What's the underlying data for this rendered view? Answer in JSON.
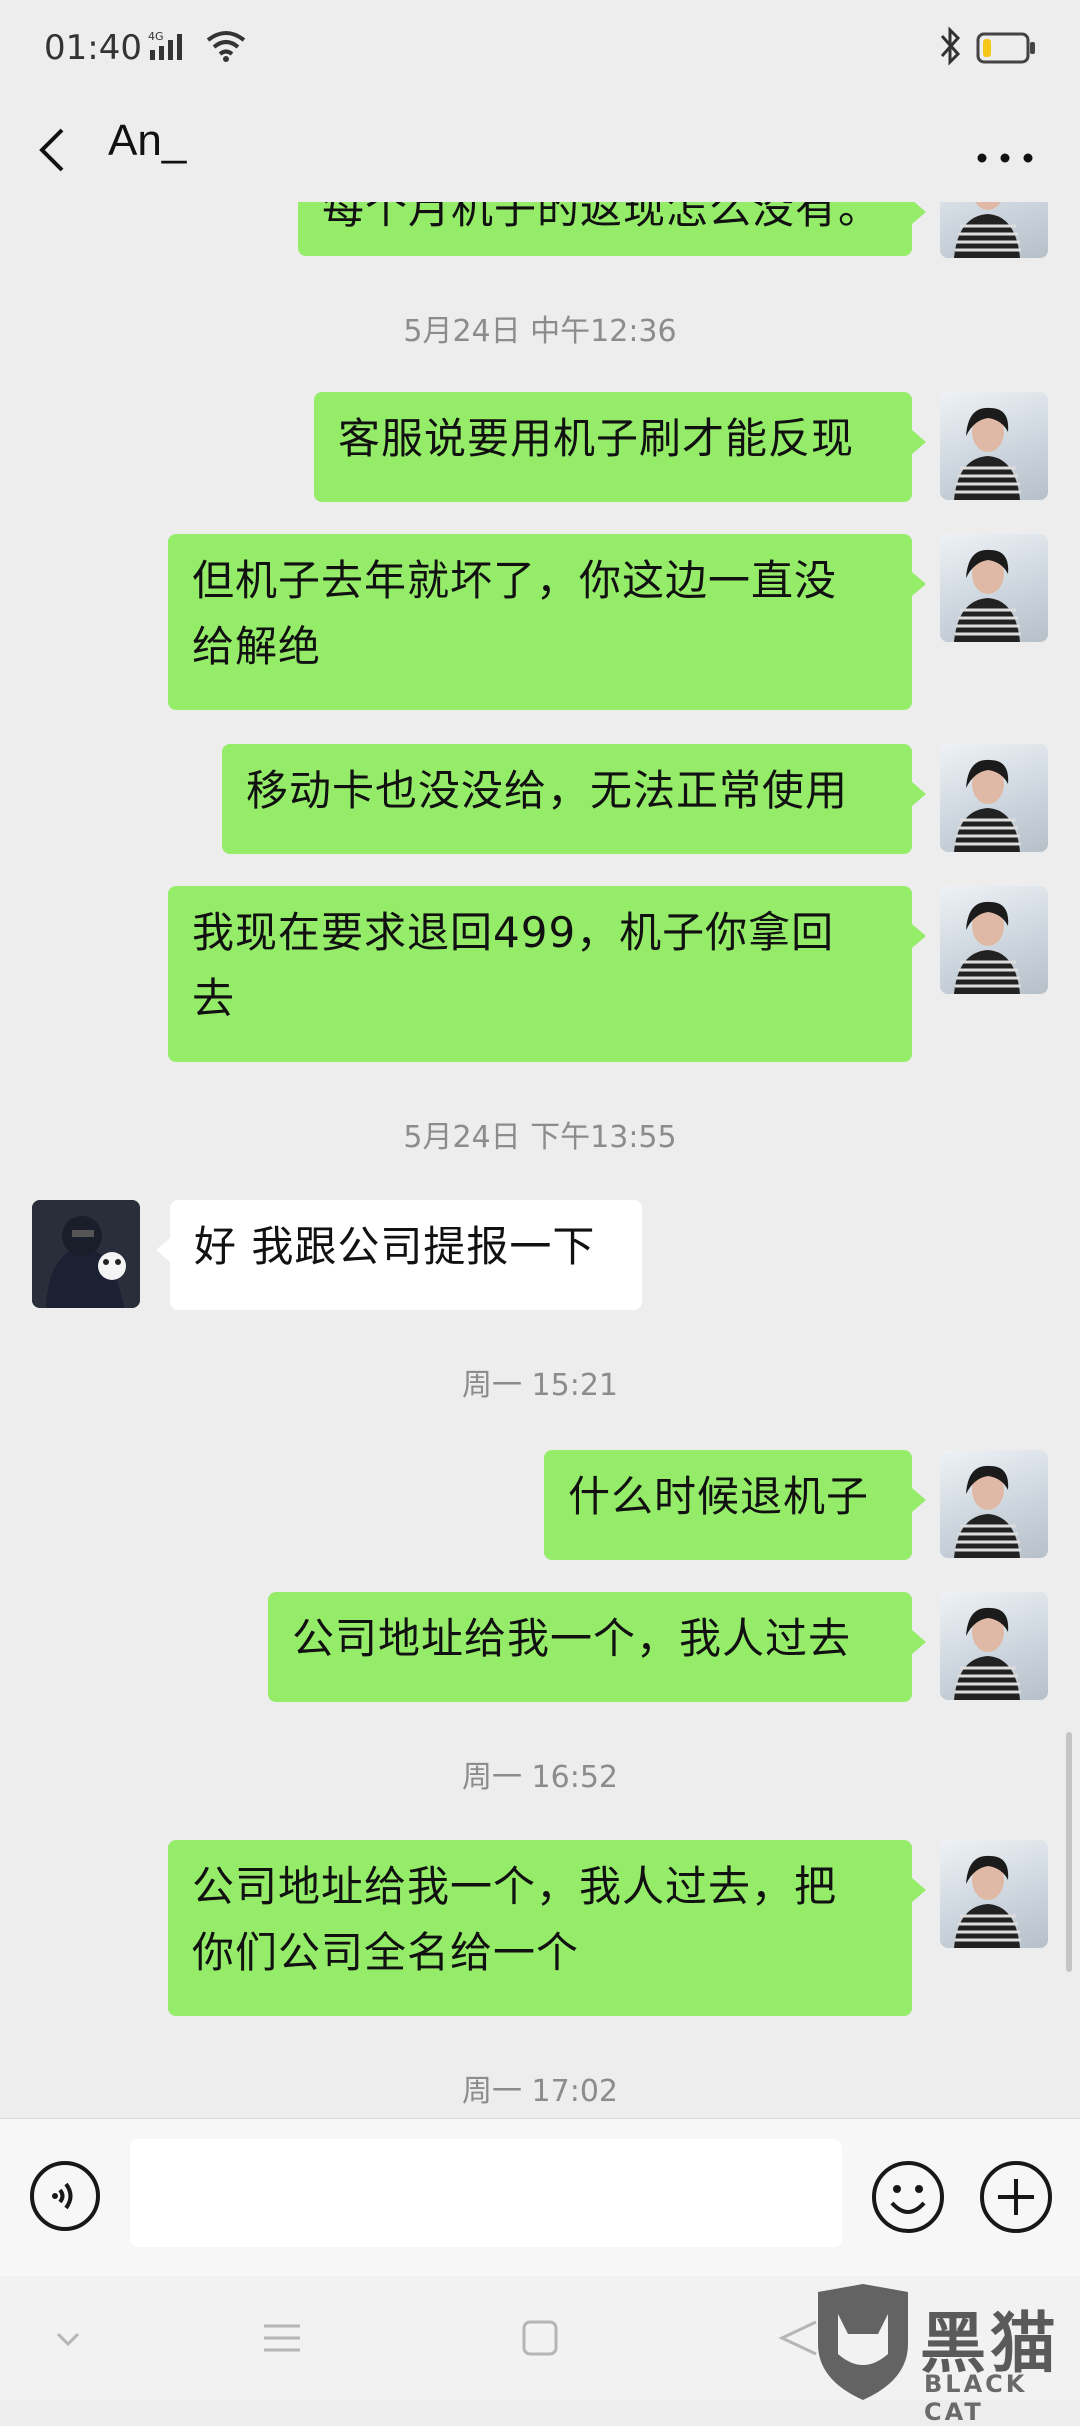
{
  "status_bar": {
    "time": "01:40",
    "network": "4G",
    "icons": [
      "signal-icon",
      "wifi-icon",
      "bluetooth-icon",
      "battery-icon"
    ],
    "battery_level": 0.2
  },
  "header": {
    "back_icon": "chevron-left-icon",
    "title": "An_",
    "more_icon": "more-dots-icon"
  },
  "messages": [
    {
      "type": "out",
      "text": "每个月机子的返现怎么没有。"
    },
    {
      "type": "time",
      "text": "5月24日 中午12:36"
    },
    {
      "type": "out",
      "lines": [
        "客服说要用机子刷才能反现"
      ]
    },
    {
      "type": "out",
      "lines": [
        "但机子去年就坏了，你这边一直没",
        "给解绝"
      ]
    },
    {
      "type": "out",
      "lines": [
        "移动卡也没没给，无法正常使用"
      ]
    },
    {
      "type": "out",
      "lines": [
        "我现在要求退回499，机子你拿回",
        "去"
      ]
    },
    {
      "type": "time",
      "text": "5月24日 下午13:55"
    },
    {
      "type": "in",
      "lines": [
        "好 我跟公司提报一下"
      ]
    },
    {
      "type": "time",
      "text": "周一 15:21"
    },
    {
      "type": "out",
      "lines": [
        "什么时候退机子"
      ]
    },
    {
      "type": "out",
      "lines": [
        "公司地址给我一个，我人过去"
      ]
    },
    {
      "type": "time",
      "text": "周一 16:52"
    },
    {
      "type": "out",
      "lines": [
        "公司地址给我一个，我人过去，把",
        "你们公司全名给一个"
      ]
    },
    {
      "type": "time",
      "text": "周一 17:02"
    }
  ],
  "input_bar": {
    "voice_icon": "voice-icon",
    "input_value": "",
    "emoji_icon": "emoji-icon",
    "plus_icon": "plus-icon"
  },
  "nav_bar": {
    "icons": [
      "collapse-icon",
      "menu-icon",
      "home-icon",
      "back-icon"
    ]
  },
  "watermark": {
    "text_cn": "黑猫",
    "text_en": "BLACK CAT"
  },
  "colors": {
    "background": "#ededed",
    "bubble_out": "#95ec69",
    "bubble_in": "#ffffff",
    "time_label": "#8c8c8c"
  }
}
